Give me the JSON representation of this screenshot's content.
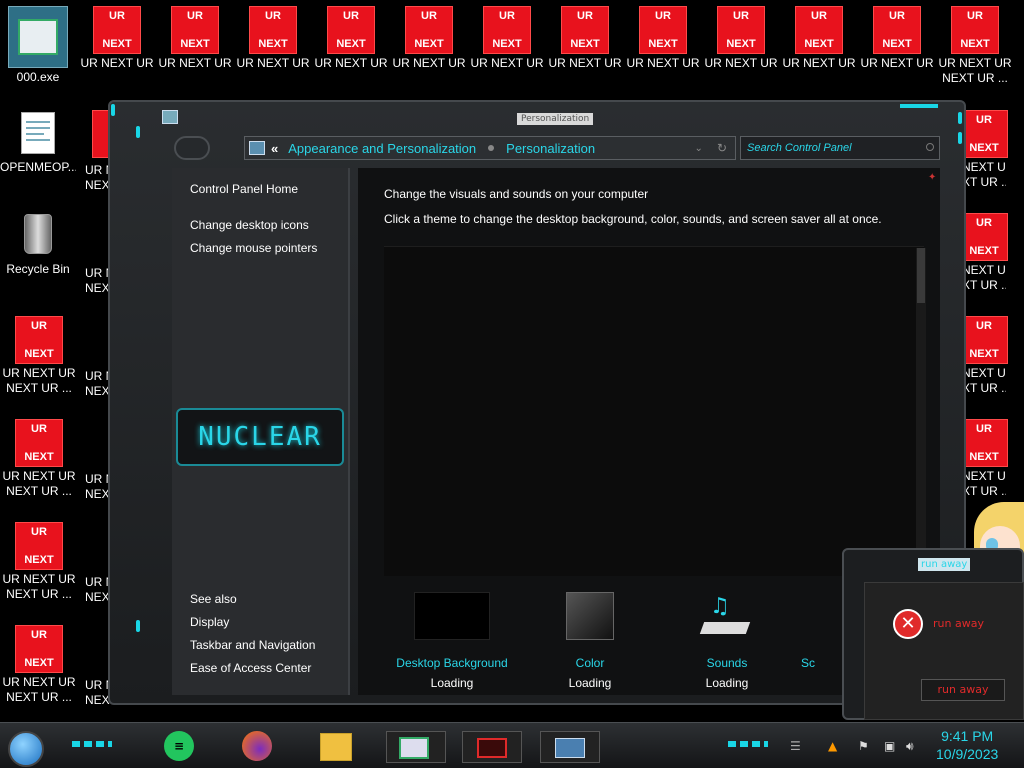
{
  "desktop": {
    "exe_label": "000.exe",
    "doc_label": "OPENMEOP...",
    "recycle_label": "Recycle Bin",
    "tile_top": "UR",
    "tile_bottom": "NEXT",
    "icon_row1_label": "UR NEXT UR",
    "icon_label_line1": "UR NEXT UR",
    "icon_label_line2": "NEXT UR ...",
    "partial_line1": "UR N",
    "partial_line2": "NEX",
    "right_partial_line1": "NEXT UR",
    "right_partial_line2": "XT UR ..."
  },
  "window": {
    "title": "Personalization",
    "breadcrumb": {
      "back": "«",
      "item1": "Appearance and Personalization",
      "item2": "Personalization"
    },
    "search_placeholder": "Search Control Panel",
    "left_pane": {
      "home": "Control Panel Home",
      "links": [
        "Change desktop icons",
        "Change mouse pointers"
      ],
      "see_also": "See also",
      "see_also_links": [
        "Display",
        "Taskbar and Navigation",
        "Ease of Access Center"
      ],
      "logo_text": "NUCLEAR"
    },
    "main": {
      "heading": "Change the visuals and sounds on your computer",
      "subheading": "Click a theme to change the desktop background, color, sounds, and screen saver all at once.",
      "options": [
        {
          "title": "Desktop Background",
          "status": "Loading"
        },
        {
          "title": "Color",
          "status": "Loading"
        },
        {
          "title": "Sounds",
          "status": "Loading"
        },
        {
          "title": "Sc",
          "status": ""
        }
      ]
    }
  },
  "error_dialog": {
    "title": "run away",
    "message": "run away",
    "button": "run away"
  },
  "taskbar": {
    "time": "9:41 PM",
    "date": "10/9/2023"
  },
  "colors": {
    "accent": "#2ad6e8",
    "tile_red": "#e8121d",
    "window_bg": "#1b1d1f"
  }
}
